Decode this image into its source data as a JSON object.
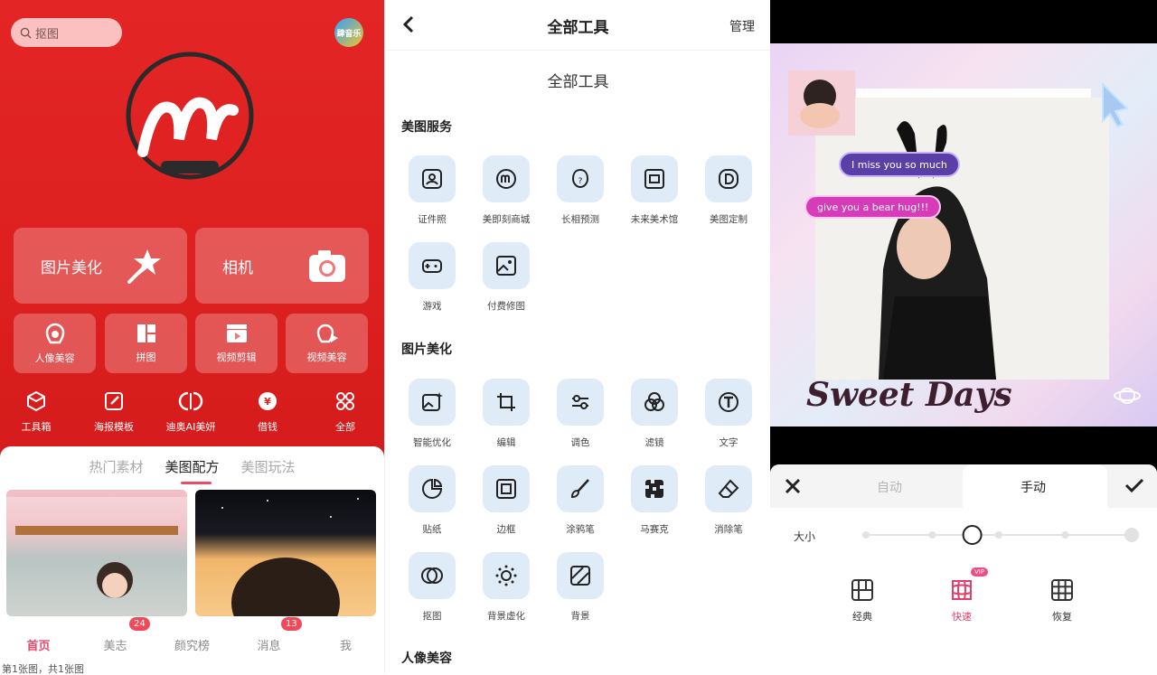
{
  "caption": "第1张图，共1张图",
  "panel1": {
    "search_placeholder": "抠图",
    "avatar_text": "肆音乐",
    "big_buttons": [
      {
        "label": "图片美化"
      },
      {
        "label": "相机"
      }
    ],
    "mid_buttons": [
      {
        "label": "人像美容"
      },
      {
        "label": "拼图"
      },
      {
        "label": "视频剪辑"
      },
      {
        "label": "视频美容"
      }
    ],
    "small_buttons": [
      {
        "label": "工具箱"
      },
      {
        "label": "海报模板"
      },
      {
        "label": "迪奥AI美妍"
      },
      {
        "label": "借钱"
      },
      {
        "label": "全部"
      }
    ],
    "tabs": [
      "热门素材",
      "美图配方",
      "美图玩法"
    ],
    "active_tab": "美图配方",
    "bottom_nav": [
      {
        "label": "首页",
        "badge": ""
      },
      {
        "label": "美志",
        "badge": "24"
      },
      {
        "label": "颜究榜",
        "badge": ""
      },
      {
        "label": "消息",
        "badge": "13"
      },
      {
        "label": "我",
        "badge": ""
      }
    ],
    "accent": "#e32525"
  },
  "panel2": {
    "title": "全部工具",
    "manage": "管理",
    "subtitle": "全部工具",
    "sections": [
      {
        "name": "美图服务",
        "tools": [
          "证件照",
          "美即刻商城",
          "长相预测",
          "未来美术馆",
          "美图定制",
          "游戏",
          "付费修图"
        ]
      },
      {
        "name": "图片美化",
        "tools": [
          "智能优化",
          "编辑",
          "调色",
          "滤镜",
          "文字",
          "贴纸",
          "边框",
          "涂鸦笔",
          "马赛克",
          "消除笔",
          "抠图",
          "背景虚化",
          "背景"
        ]
      },
      {
        "name": "人像美容",
        "tools": []
      }
    ]
  },
  "panel3": {
    "bubble1": "I miss you so much",
    "bubble2": "give you a bear hug!!!",
    "photo_text": "Sweet Days",
    "tabs": [
      "自动",
      "手动"
    ],
    "active_tab": "手动",
    "size_label": "大小",
    "slider_level": 0.4,
    "tools": [
      {
        "label": "经典"
      },
      {
        "label": "快速",
        "vip": "VIP"
      },
      {
        "label": "恢复"
      }
    ],
    "active_tool": "快速"
  }
}
